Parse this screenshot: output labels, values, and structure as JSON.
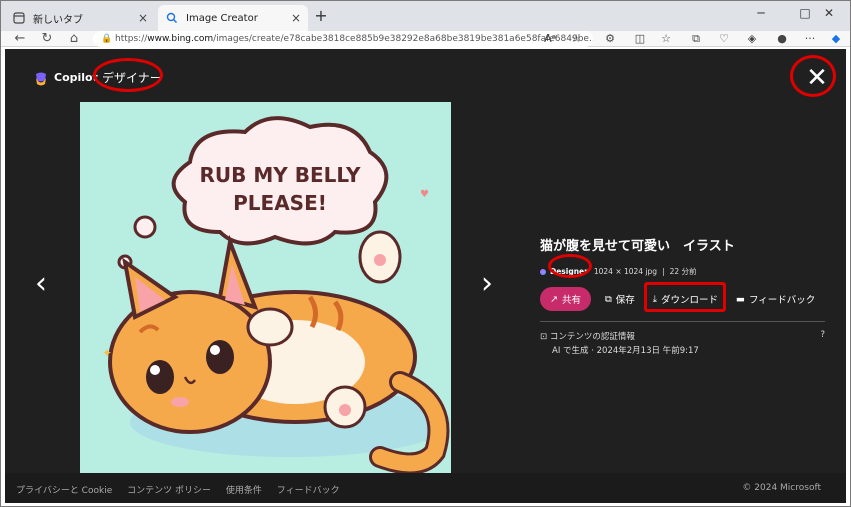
{
  "tabs": [
    {
      "label": "新しいタブ",
      "close": "×"
    },
    {
      "label": "Image Creator",
      "close": "×"
    }
  ],
  "new_tab": "+",
  "window": {
    "minimize": "─",
    "maximize": "□",
    "close": "✕"
  },
  "address": {
    "scheme": "https://",
    "host": "www.bing.com",
    "path": "/images/create/e78cabe3818ce885b9e38292e8a68be3819be381a6e58fafe6849be..."
  },
  "header": {
    "brand": "Copilot",
    "designer_label": "デザイナー",
    "close": "✕"
  },
  "nav": {
    "prev": "‹",
    "next": "›"
  },
  "image": {
    "speech_line1": "RUB MY BELLY",
    "speech_line2": "PLEASE!"
  },
  "details": {
    "title": "猫が腹を見せて可愛い　イラスト",
    "badge": "Designer",
    "dimensions": "1024 × 1024 jpg",
    "separator": "|",
    "time_ago": "22 分前"
  },
  "actions": {
    "share": "共有",
    "save": "保存",
    "download": "ダウンロード",
    "feedback": "フィードバック"
  },
  "credentials": {
    "title": "コンテンツの認証情報",
    "line": "AI で生成 · 2024年2月13日 午前9:17",
    "help": "?"
  },
  "footer": {
    "links": [
      "プライバシーと Cookie",
      "コンテンツ ポリシー",
      "使用条件",
      "フィードバック"
    ],
    "copyright": "© 2024 Microsoft"
  }
}
